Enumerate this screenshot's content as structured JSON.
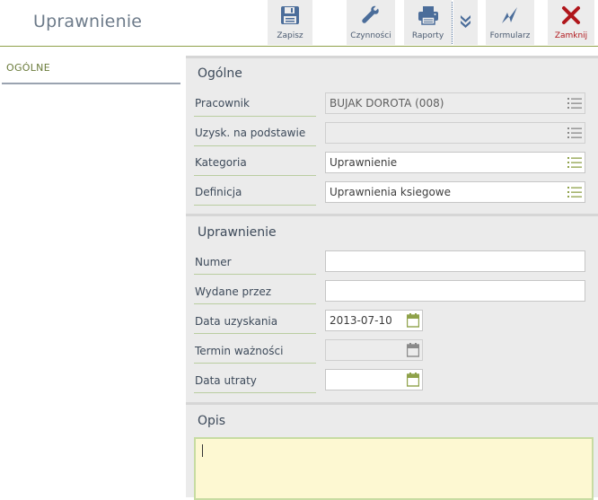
{
  "window": {
    "title": "Uprawnienie"
  },
  "toolbar": {
    "save": "Zapisz",
    "actions": "Czynności",
    "reports": "Raporty",
    "form": "Formularz",
    "close": "Zamknij"
  },
  "nav": {
    "general": "OGÓLNE"
  },
  "section_general": {
    "title": "Ogólne",
    "employee_label": "Pracownik",
    "employee_value": "BUJAK DOROTA (008)",
    "basis_label": "Uzysk. na podstawie",
    "basis_value": "",
    "category_label": "Kategoria",
    "category_value": "Uprawnienie",
    "definition_label": "Definicja",
    "definition_value": "Uprawnienia ksiegowe"
  },
  "section_permission": {
    "title": "Uprawnienie",
    "number_label": "Numer",
    "number_value": "",
    "issued_by_label": "Wydane przez",
    "issued_by_value": "",
    "date_obtained_label": "Data uzyskania",
    "date_obtained_value": "2013-07-10",
    "validity_label": "Termin ważności",
    "validity_value": "",
    "date_lost_label": "Data utraty",
    "date_lost_value": ""
  },
  "section_description": {
    "title": "Opis",
    "value": ""
  },
  "colors": {
    "accent_green": "#8fa24a",
    "close_red": "#b0161b",
    "icon_blue": "#4b6d9a"
  }
}
